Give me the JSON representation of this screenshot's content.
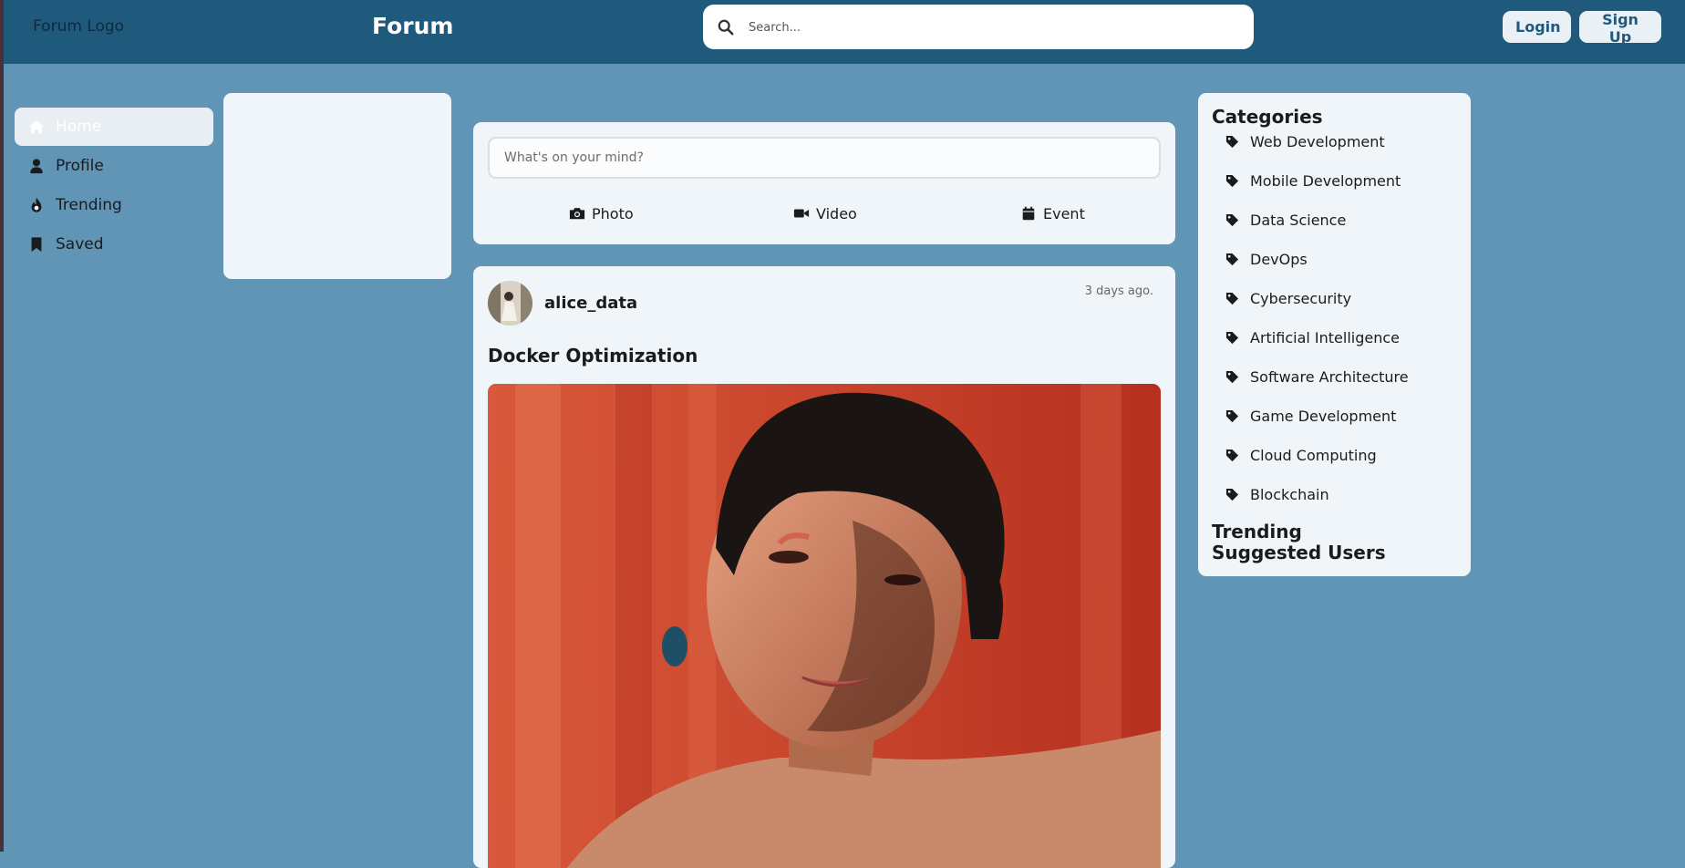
{
  "header": {
    "logo": "Forum Logo",
    "brand": "Forum",
    "search_placeholder": "Search...",
    "login_label": "Login",
    "signup_label": "Sign Up"
  },
  "nav": {
    "items": [
      {
        "label": "Home",
        "icon": "home-icon",
        "active": true
      },
      {
        "label": "Profile",
        "icon": "user-icon"
      },
      {
        "label": "Trending",
        "icon": "fire-icon"
      },
      {
        "label": "Saved",
        "icon": "bookmark-icon"
      }
    ]
  },
  "composer": {
    "placeholder": "What's on your mind?",
    "actions": [
      {
        "label": "Photo",
        "icon": "camera-icon"
      },
      {
        "label": "Video",
        "icon": "video-icon"
      },
      {
        "label": "Event",
        "icon": "calendar-icon"
      }
    ]
  },
  "post": {
    "username": "alice_data",
    "timestamp": "3 days ago.",
    "title": "Docker Optimization"
  },
  "sidebar": {
    "categories_heading": "Categories",
    "categories": [
      "Web Development",
      "Mobile Development",
      "Data Science",
      "DevOps",
      "Cybersecurity",
      "Artificial Intelligence",
      "Software Architecture",
      "Game Development",
      "Cloud Computing",
      "Blockchain"
    ],
    "trending_heading": "Trending",
    "suggested_heading": "Suggested Users"
  },
  "colors": {
    "page_bg": "#6095b6",
    "header_bg": "#1f5a7d",
    "card_bg": "#f0f5f9",
    "accent": "#1f5a7d"
  }
}
